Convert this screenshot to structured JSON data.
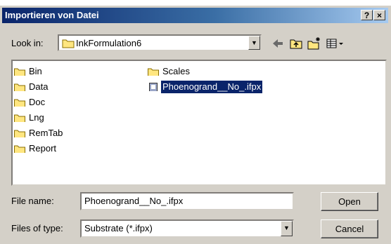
{
  "window": {
    "title": "Importieren von Datei",
    "help_glyph": "?",
    "close_glyph": "×"
  },
  "toolbar": {
    "lookin_label": "Look in:",
    "lookin_value": "InkFormulation6",
    "icons": [
      "folder-icon",
      "back-arrow-icon",
      "up-folder-icon",
      "new-folder-icon",
      "view-menu-icon"
    ]
  },
  "files": [
    {
      "name": "Bin",
      "type": "folder"
    },
    {
      "name": "Data",
      "type": "folder"
    },
    {
      "name": "Doc",
      "type": "folder"
    },
    {
      "name": "Lng",
      "type": "folder"
    },
    {
      "name": "RemTab",
      "type": "folder"
    },
    {
      "name": "Report",
      "type": "folder"
    },
    {
      "name": "Scales",
      "type": "folder"
    },
    {
      "name": "Phoenogrand__No_.ifpx",
      "type": "file",
      "selected": true
    }
  ],
  "filename": {
    "label": "File name:",
    "value": "Phoenogrand__No_.ifpx"
  },
  "filetype": {
    "label": "Files of type:",
    "value": "Substrate (*.ifpx)"
  },
  "buttons": {
    "open": "Open",
    "cancel": "Cancel"
  },
  "colors": {
    "titlebar_start": "#0a246a",
    "titlebar_end": "#a6caf0",
    "selection": "#0a246a",
    "dialog_bg": "#d4d0c8"
  }
}
